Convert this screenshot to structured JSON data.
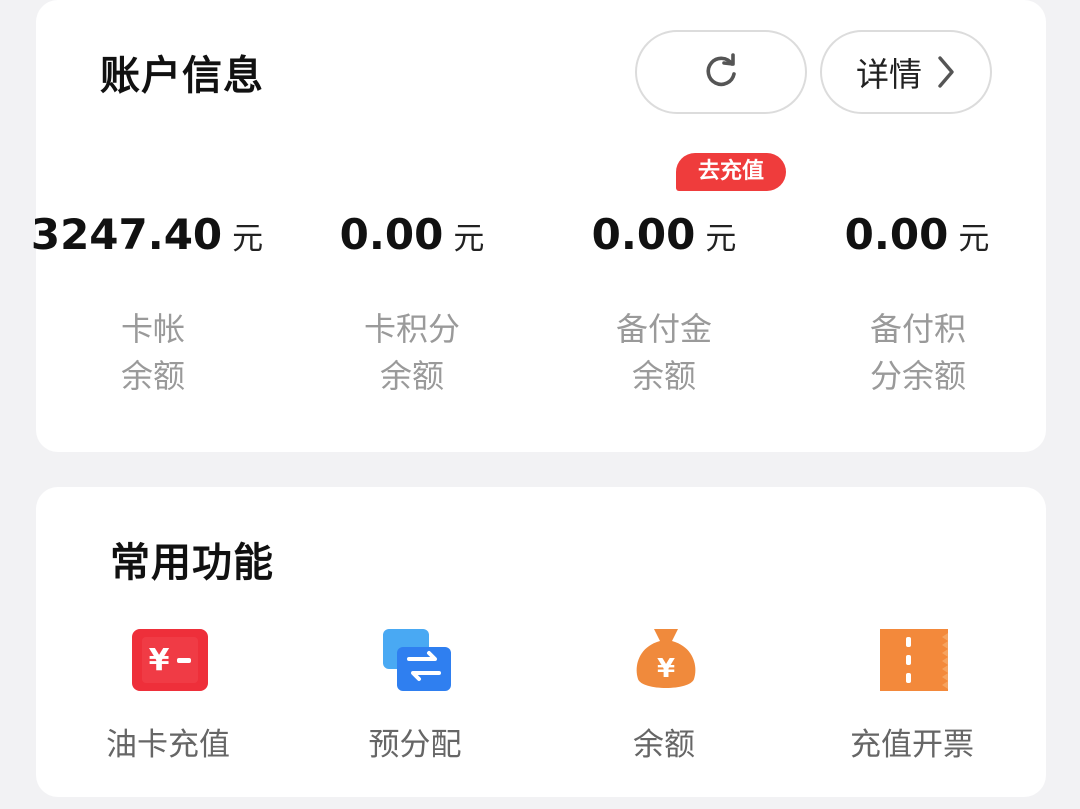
{
  "account": {
    "title": "账户信息",
    "detail_label": "详情",
    "recharge_badge": "去充值",
    "balances": [
      {
        "amount": "3247.40",
        "unit": "元",
        "label_line1": "卡帐",
        "label_line2": "余额"
      },
      {
        "amount": "0.00",
        "unit": "元",
        "label_line1": "卡积分",
        "label_line2": "余额"
      },
      {
        "amount": "0.00",
        "unit": "元",
        "label_line1": "备付金",
        "label_line2": "余额"
      },
      {
        "amount": "0.00",
        "unit": "元",
        "label_line1": "备付积",
        "label_line2": "分余额"
      }
    ]
  },
  "features": {
    "title": "常用功能",
    "items": [
      {
        "label": "油卡充值",
        "icon": "yuan-minus-card-icon",
        "color": "#ee2f3a"
      },
      {
        "label": "预分配",
        "icon": "transfer-arrows-icon",
        "color": "#2f7ff0"
      },
      {
        "label": "余额",
        "icon": "money-bag-icon",
        "color": "#f08a3c"
      },
      {
        "label": "充值开票",
        "icon": "ticket-icon",
        "color": "#f3893b"
      }
    ]
  },
  "icons": {
    "refresh": "refresh-icon",
    "detail_arrow": "chevron-right-icon"
  }
}
